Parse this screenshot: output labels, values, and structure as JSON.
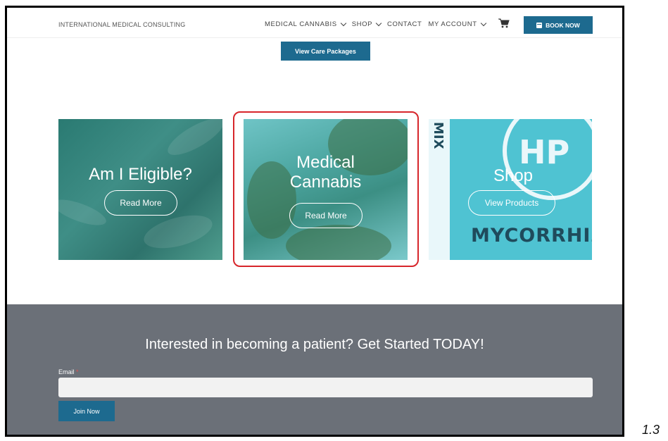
{
  "header": {
    "brand": "INTERNATIONAL MEDICAL CONSULTING",
    "nav": [
      {
        "label": "MEDICAL CANNABIS",
        "has_dropdown": true
      },
      {
        "label": "SHOP",
        "has_dropdown": true
      },
      {
        "label": "CONTACT",
        "has_dropdown": false
      },
      {
        "label": "MY ACCOUNT",
        "has_dropdown": true
      }
    ],
    "cart_icon": "cart-icon",
    "book_label": "BOOK NOW"
  },
  "care_button": "View Care Packages",
  "cards": [
    {
      "title": "Am I Eligible?",
      "button": "Read More"
    },
    {
      "title": "Medical Cannabis",
      "title_line1": "Medical",
      "title_line2": "Cannabis",
      "button": "Read More"
    },
    {
      "title": "Shop",
      "button": "View Products",
      "image_text_1": "HP",
      "image_text_2": "MYCORRHIZ",
      "image_text_3": "MIX"
    }
  ],
  "footer": {
    "cta": "Interested in becoming a patient? Get Started TODAY!",
    "email_label": "Email",
    "required_mark": "*",
    "email_value": "",
    "join_label": "Join Now"
  },
  "figure_label": "1.3",
  "colors": {
    "accent": "#1d6a8f",
    "highlight": "#d7262b",
    "footer_bg": "#6b7078"
  }
}
